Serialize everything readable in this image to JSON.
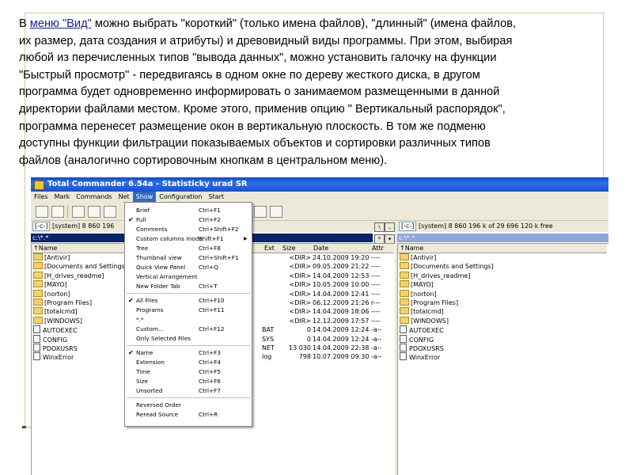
{
  "paragraph": {
    "line1_pre": "В ",
    "line1_link": "меню \"Вид\"",
    "line1_post": " можно выбрать \"короткий\" (только имена файлов), \"длинный\" (имена файлов,",
    "line2": "их размер, дата создания и атрибуты) и древовидный виды программы. При этом, выбирая",
    "line3": "любой из перечисленных типов \"вывода данных\", можно установить галочку на функции",
    "line4": "\"Быстрый просмотр\" - передвигаясь в одном окне по дереву жесткого диска, в другом",
    "line5": "программа будет одновременно информировать о занимаемом размещенными в данной",
    "line6": "директории файлами местом. Кроме этого, применив опцию \" Вертикальный распорядок\",",
    "line7": "программа перенесет размещение окон в вертикальную плоскость. В том же подменю",
    "line8": "доступны функции фильтрации показываемых объектов и сортировки различных типов",
    "line9": "файлов (аналогично сортировочным кнопкам в центральном меню)."
  },
  "window": {
    "title": "Total Commander 6.54a - Statisticky urad SR",
    "menu": [
      "Files",
      "Mark",
      "Commands",
      "Net",
      "Show",
      "Configuration",
      "Start"
    ],
    "active_menu": "Show"
  },
  "left_panel": {
    "drive": "[-c-]",
    "drive_info": "[system]  8 860 196",
    "path": "c:\\*.*",
    "headers": {
      "name": "↑Name",
      "ext": "Ext",
      "size": "Size",
      "date": "Date",
      "attr": "Attr"
    },
    "rows": [
      {
        "name": "[Antivir]",
        "ext": "",
        "size": "<DIR>",
        "date": "24.10.2009 19:20",
        "attr": "----",
        "type": "folder"
      },
      {
        "name": "[Documents and Settings]",
        "ext": "",
        "size": "<DIR>",
        "date": "09.05.2009 21:22",
        "attr": "----",
        "type": "folder"
      },
      {
        "name": "[H_drives_readme]",
        "ext": "",
        "size": "<DIR>",
        "date": "14.04.2009 12:53",
        "attr": "----",
        "type": "folder"
      },
      {
        "name": "[MAYO]",
        "ext": "",
        "size": "<DIR>",
        "date": "10.05.2009 10:00",
        "attr": "----",
        "type": "folder"
      },
      {
        "name": "[norton]",
        "ext": "",
        "size": "<DIR>",
        "date": "14.04.2009 12:41",
        "attr": "----",
        "type": "folder"
      },
      {
        "name": "[Program Files]",
        "ext": "",
        "size": "<DIR>",
        "date": "06.12.2009 21:26",
        "attr": "r---",
        "type": "folder"
      },
      {
        "name": "[totalcmd]",
        "ext": "",
        "size": "<DIR>",
        "date": "14.04.2009 18:06",
        "attr": "----",
        "type": "folder"
      },
      {
        "name": "[WINDOWS]",
        "ext": "",
        "size": "<DIR>",
        "date": "12.12.2009 17:57",
        "attr": "----",
        "type": "folder"
      },
      {
        "name": "AUTOEXEC",
        "ext": "BAT",
        "size": "0",
        "date": "14.04.2009 12:24",
        "attr": "-a--",
        "type": "file"
      },
      {
        "name": "CONFIG",
        "ext": "SYS",
        "size": "0",
        "date": "14.04.2009 12:24",
        "attr": "-a--",
        "type": "file"
      },
      {
        "name": "PDOXUSRS",
        "ext": "NET",
        "size": "13 030",
        "date": "14.04.2009 22:38",
        "attr": "-a--",
        "type": "file"
      },
      {
        "name": "WinxError",
        "ext": "log",
        "size": "798",
        "date": "10.07.2009 09:30",
        "attr": "-a--",
        "type": "file"
      }
    ]
  },
  "right_panel": {
    "drive": "[-c-]",
    "drive_info": "[system]  8 860 196 k of 29 696 120 k free",
    "path": "c:\\*.*",
    "header": "↑Name",
    "rows": [
      {
        "name": "[Antivir]",
        "type": "folder"
      },
      {
        "name": "[Documents and Settings]",
        "type": "folder"
      },
      {
        "name": "[H_drives_readme]",
        "type": "folder"
      },
      {
        "name": "[MAYO]",
        "type": "folder"
      },
      {
        "name": "[norton]",
        "type": "folder"
      },
      {
        "name": "[Program Files]",
        "type": "folder"
      },
      {
        "name": "[totalcmd]",
        "type": "folder"
      },
      {
        "name": "[WINDOWS]",
        "type": "folder"
      },
      {
        "name": "AUTOEXEC",
        "type": "file"
      },
      {
        "name": "CONFIG",
        "type": "file"
      },
      {
        "name": "PDOXUSRS",
        "type": "file"
      },
      {
        "name": "WinxError",
        "type": "file"
      }
    ]
  },
  "show_menu": {
    "items": [
      {
        "label": "Brief",
        "shortcut": "Ctrl+F1",
        "checked": false
      },
      {
        "label": "Full",
        "shortcut": "Ctrl+F2",
        "checked": true
      },
      {
        "label": "Comments",
        "shortcut": "Ctrl+Shift+F2",
        "checked": false
      },
      {
        "label": "Custom columns mode",
        "shortcut": "Shift+F1",
        "checked": false,
        "submenu": true
      },
      {
        "label": "Tree",
        "shortcut": "Ctrl+F8",
        "checked": false
      },
      {
        "label": "Thumbnail view",
        "shortcut": "Ctrl+Shift+F1",
        "checked": false
      },
      {
        "label": "Quick View Panel",
        "shortcut": "Ctrl+Q",
        "checked": false
      },
      {
        "label": "Vertical Arrangement",
        "shortcut": "",
        "checked": false
      },
      {
        "label": "New Folder Tab",
        "shortcut": "Ctrl+T",
        "checked": false
      },
      {
        "label": "All Files",
        "shortcut": "Ctrl+F10",
        "checked": true
      },
      {
        "label": "Programs",
        "shortcut": "Ctrl+F11",
        "checked": false
      },
      {
        "label": "*.*",
        "shortcut": "",
        "checked": false
      },
      {
        "label": "Custom...",
        "shortcut": "Ctrl+F12",
        "checked": false
      },
      {
        "label": "Only Selected Files",
        "shortcut": "",
        "checked": false
      },
      {
        "label": "Name",
        "shortcut": "Ctrl+F3",
        "checked": true
      },
      {
        "label": "Extension",
        "shortcut": "Ctrl+F4",
        "checked": false
      },
      {
        "label": "Time",
        "shortcut": "Ctrl+F5",
        "checked": false
      },
      {
        "label": "Size",
        "shortcut": "Ctrl+F6",
        "checked": false
      },
      {
        "label": "Unsorted",
        "shortcut": "Ctrl+F7",
        "checked": false
      },
      {
        "label": "Reversed Order",
        "shortcut": "",
        "checked": false
      },
      {
        "label": "Reread Source",
        "shortcut": "Ctrl+R",
        "checked": false
      }
    ],
    "check_glyph": "✔",
    "submenu_glyph": "▶"
  }
}
